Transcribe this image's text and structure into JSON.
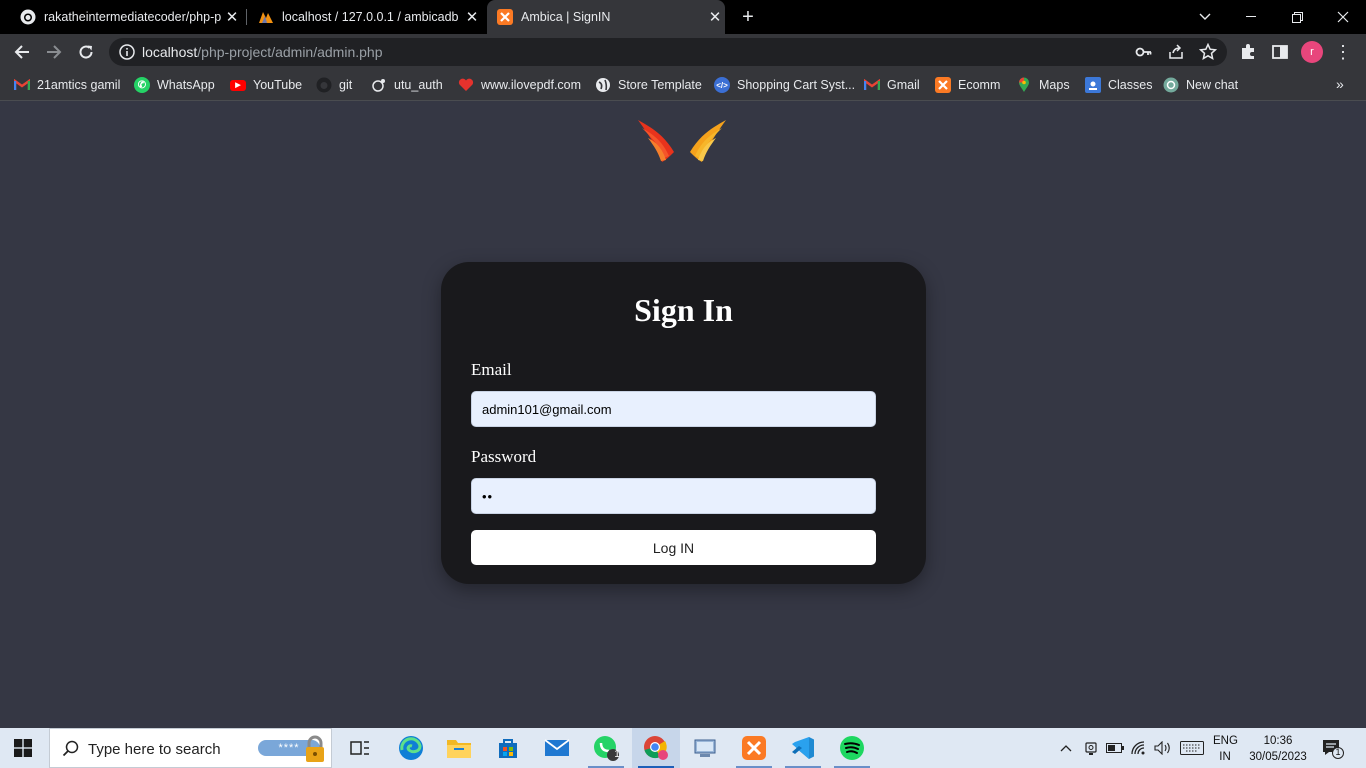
{
  "browser": {
    "tabs": [
      {
        "title": "rakatheintermediatecoder/php-p",
        "favicon": "github-icon",
        "active": false
      },
      {
        "title": "localhost / 127.0.0.1 / ambicadb /",
        "favicon": "phpmyadmin-icon",
        "active": false
      },
      {
        "title": "Ambica | SignIN",
        "favicon": "xampp-icon",
        "active": true
      }
    ],
    "address": {
      "host": "localhost",
      "path": "/php-project/admin/admin.php"
    },
    "profile_initial": "r",
    "bookmarks": [
      {
        "label": "21amtics gamil",
        "icon": "gmail-icon"
      },
      {
        "label": "WhatsApp",
        "icon": "whatsapp-icon"
      },
      {
        "label": "YouTube",
        "icon": "youtube-icon"
      },
      {
        "label": "git",
        "icon": "github-icon"
      },
      {
        "label": "utu_auth",
        "icon": "utu-icon"
      },
      {
        "label": "www.ilovepdf.com",
        "icon": "ilovepdf-icon"
      },
      {
        "label": "Store Template",
        "icon": "globe-icon"
      },
      {
        "label": "Shopping Cart Syst...",
        "icon": "code-icon"
      },
      {
        "label": "Gmail",
        "icon": "gmail-icon"
      },
      {
        "label": "Ecomm",
        "icon": "xampp-icon"
      },
      {
        "label": "Maps",
        "icon": "maps-icon"
      },
      {
        "label": "Classes",
        "icon": "classroom-icon"
      },
      {
        "label": "New chat",
        "icon": "chatgpt-icon"
      }
    ]
  },
  "page": {
    "title": "Sign In",
    "email_label": "Email",
    "email_value": "admin101@gmail.com",
    "password_label": "Password",
    "password_value": "••",
    "login_label": "Log IN"
  },
  "taskbar": {
    "search_placeholder": "Type here to search",
    "password_badge": "****",
    "whatsapp_badge": "1",
    "lang_line1": "ENG",
    "lang_line2": "IN",
    "time": "10:36",
    "date": "30/05/2023",
    "notification_count": "1"
  }
}
